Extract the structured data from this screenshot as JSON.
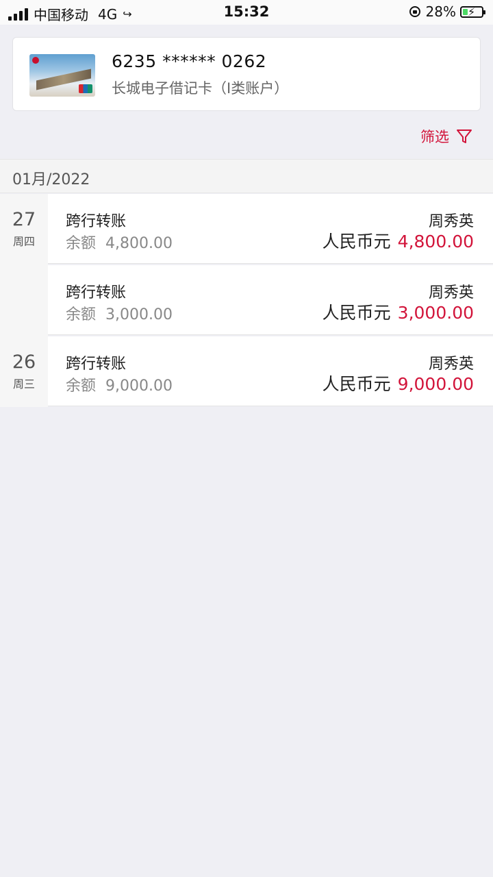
{
  "status_bar": {
    "carrier": "中国移动",
    "network": "4G",
    "time": "15:32",
    "battery_percent": "28%",
    "battery_level": 0.28
  },
  "card": {
    "number": "6235 ****** 0262",
    "type": "长城电子借记卡（I类账户）"
  },
  "filter": {
    "label": "筛选"
  },
  "month": "01月/2022",
  "balance_label": "余额",
  "days": [
    {
      "day": "27",
      "weekday": "周四"
    },
    {
      "day": "26",
      "weekday": "周三"
    }
  ],
  "transactions": [
    {
      "type": "跨行转账",
      "balance": "4,800.00",
      "party": "周秀英",
      "currency": "人民币元",
      "amount": "4,800.00"
    },
    {
      "type": "跨行转账",
      "balance": "3,000.00",
      "party": "周秀英",
      "currency": "人民币元",
      "amount": "3,000.00"
    },
    {
      "type": "跨行转账",
      "balance": "9,000.00",
      "party": "周秀英",
      "currency": "人民币元",
      "amount": "9,000.00"
    }
  ],
  "colors": {
    "accent": "#d2143a",
    "background": "#efeff4"
  }
}
